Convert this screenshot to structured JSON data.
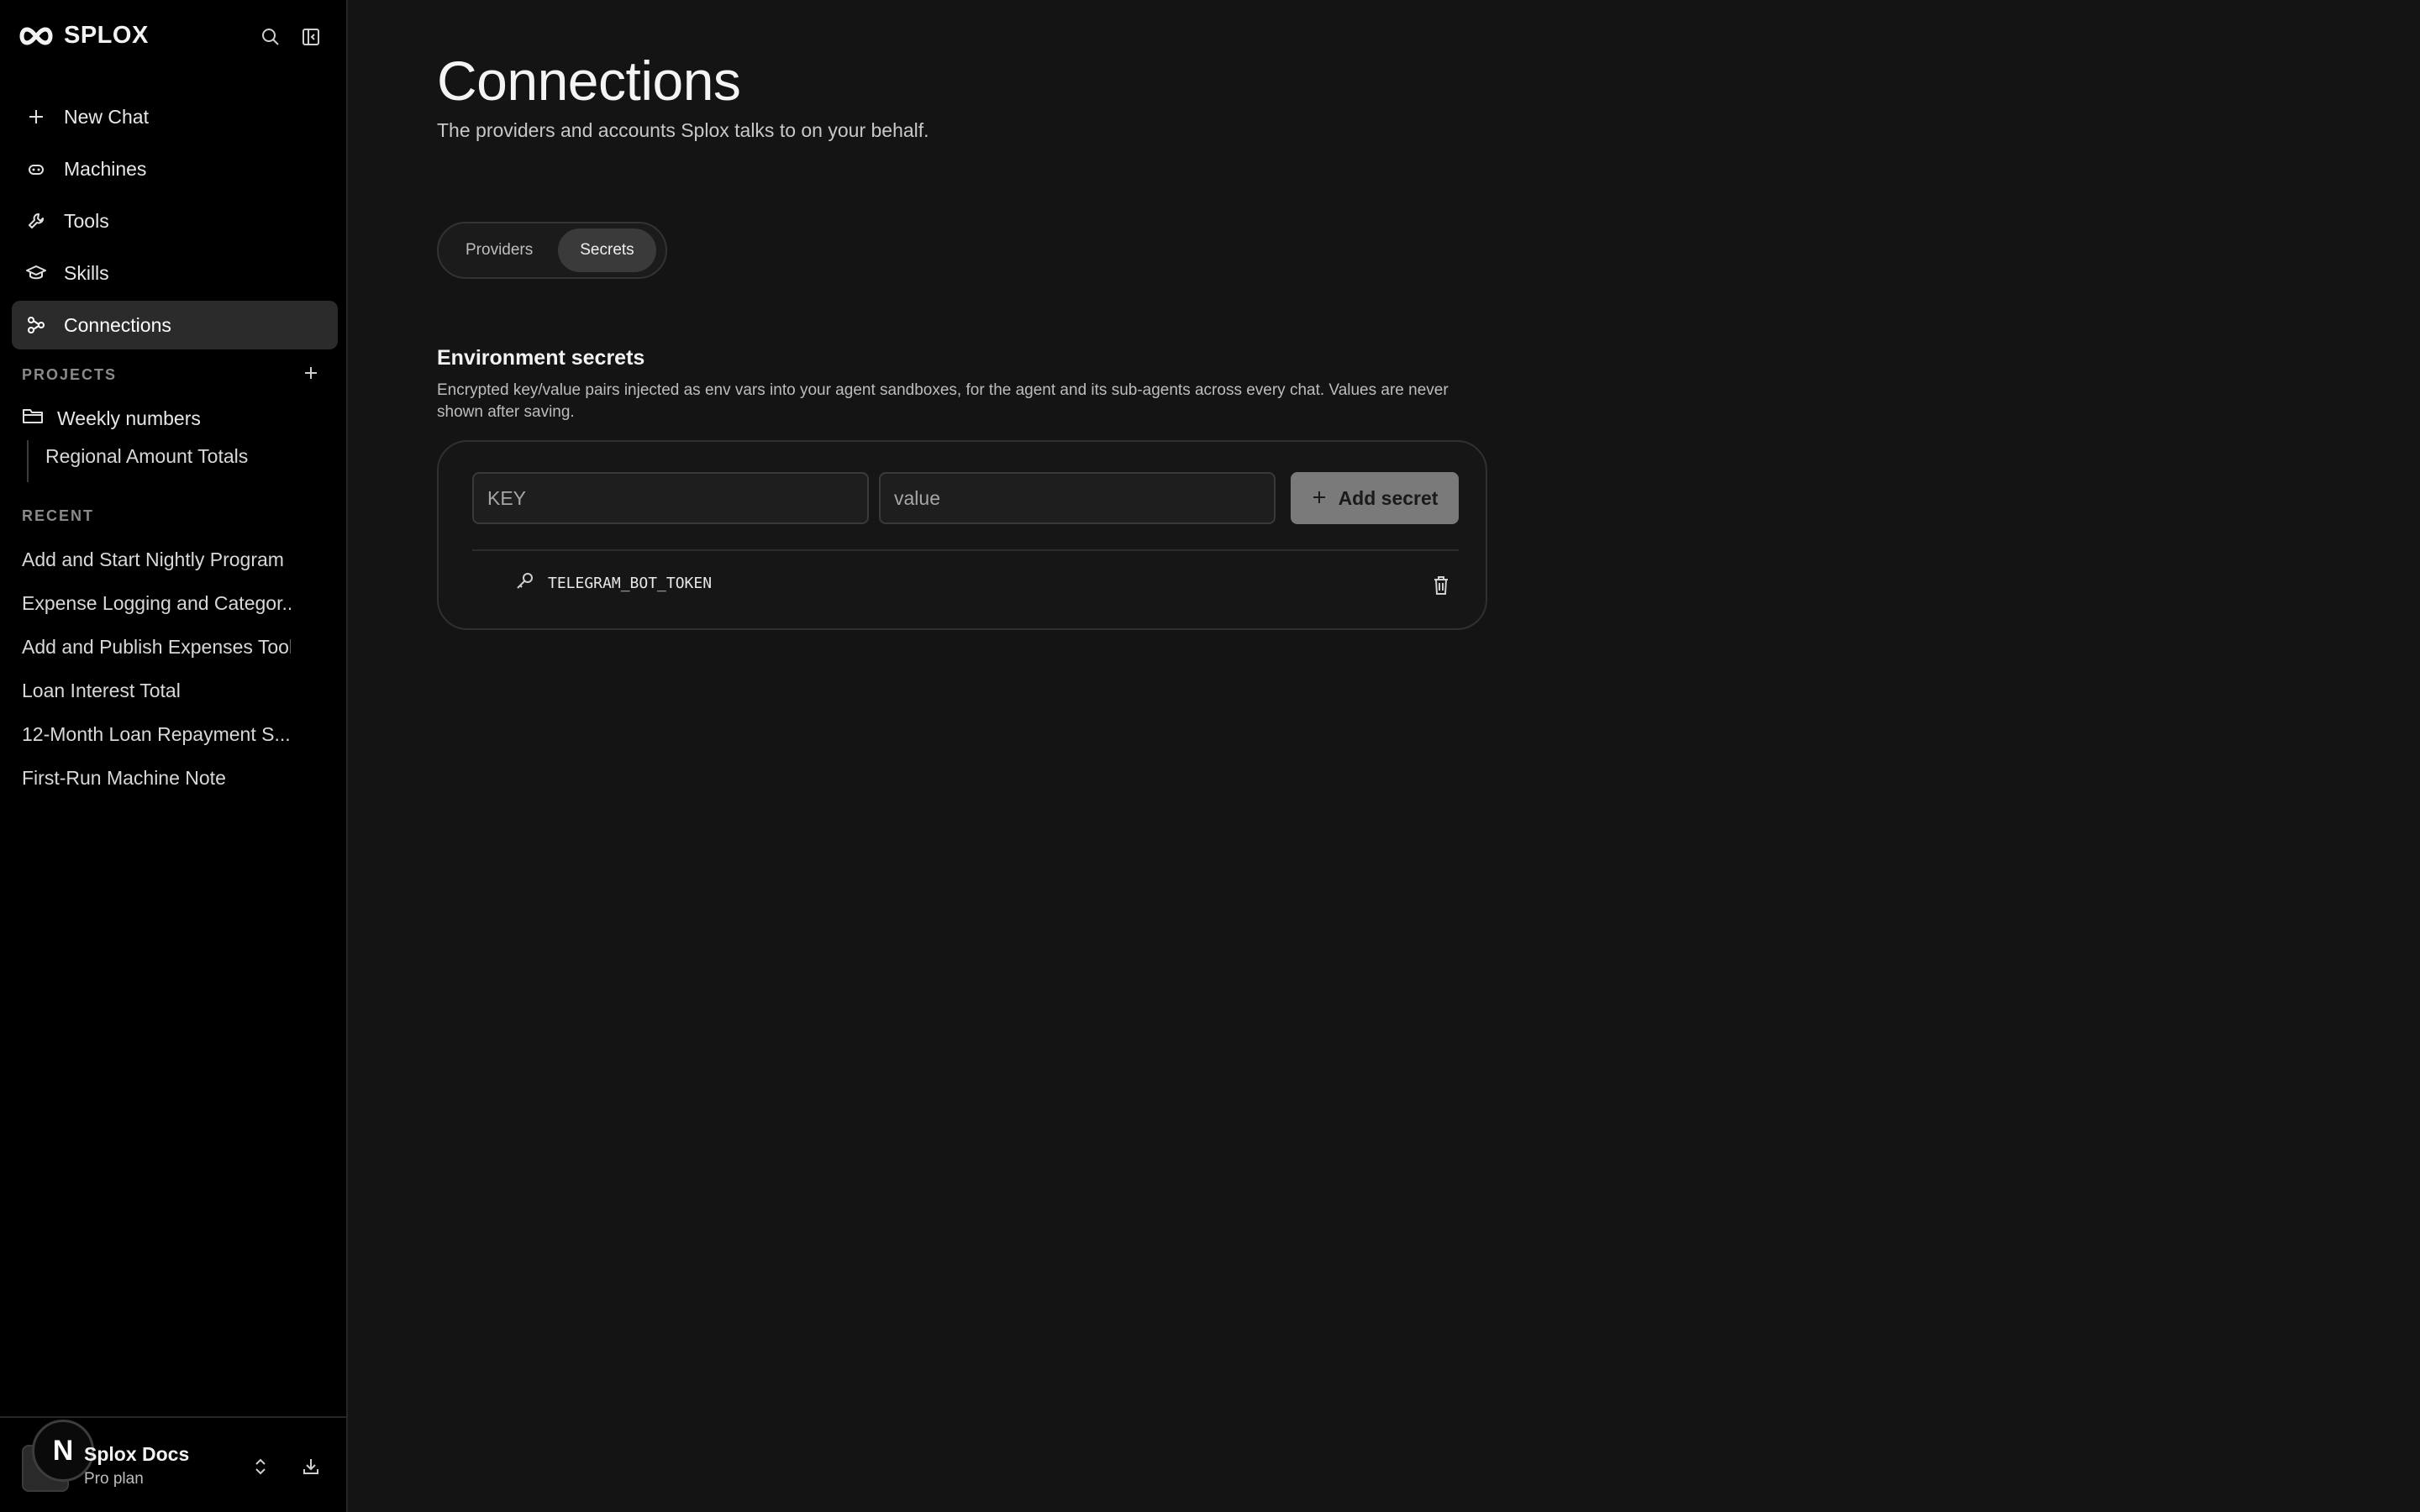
{
  "brand": {
    "name": "SPLOX"
  },
  "nav": [
    {
      "label": "New Chat"
    },
    {
      "label": "Machines"
    },
    {
      "label": "Tools"
    },
    {
      "label": "Skills"
    },
    {
      "label": "Connections",
      "active": true
    }
  ],
  "projects": {
    "label": "PROJECTS",
    "items": [
      {
        "label": "Weekly numbers",
        "children": [
          "Regional Amount Totals"
        ]
      }
    ]
  },
  "recent": {
    "label": "RECENT",
    "items": [
      "Add and Start Nightly Program",
      "Expense Logging and Categor...",
      "Add and Publish Expenses Tool",
      "Loan Interest Total",
      "12-Month Loan Repayment S...",
      "First-Run Machine Note"
    ]
  },
  "account": {
    "avatar_letter": "N",
    "name": "Splox Docs",
    "plan": "Pro plan"
  },
  "page": {
    "title": "Connections",
    "subtitle": "The providers and accounts Splox talks to on your behalf."
  },
  "tabs": [
    {
      "label": "Providers"
    },
    {
      "label": "Secrets",
      "active": true
    }
  ],
  "secrets": {
    "heading": "Environment secrets",
    "description": "Encrypted key/value pairs injected as env vars into your agent sandboxes, for the agent and its sub-agents across every chat. Values are never shown after saving.",
    "key_placeholder": "KEY",
    "value_placeholder": "value",
    "add_label": "Add secret",
    "items": [
      {
        "name": "TELEGRAM_BOT_TOKEN"
      }
    ]
  },
  "colors": {
    "background": "#141414",
    "sidebar": "#000000",
    "active_item": "#2b2b2b",
    "add_button": "#7a7a7a"
  }
}
